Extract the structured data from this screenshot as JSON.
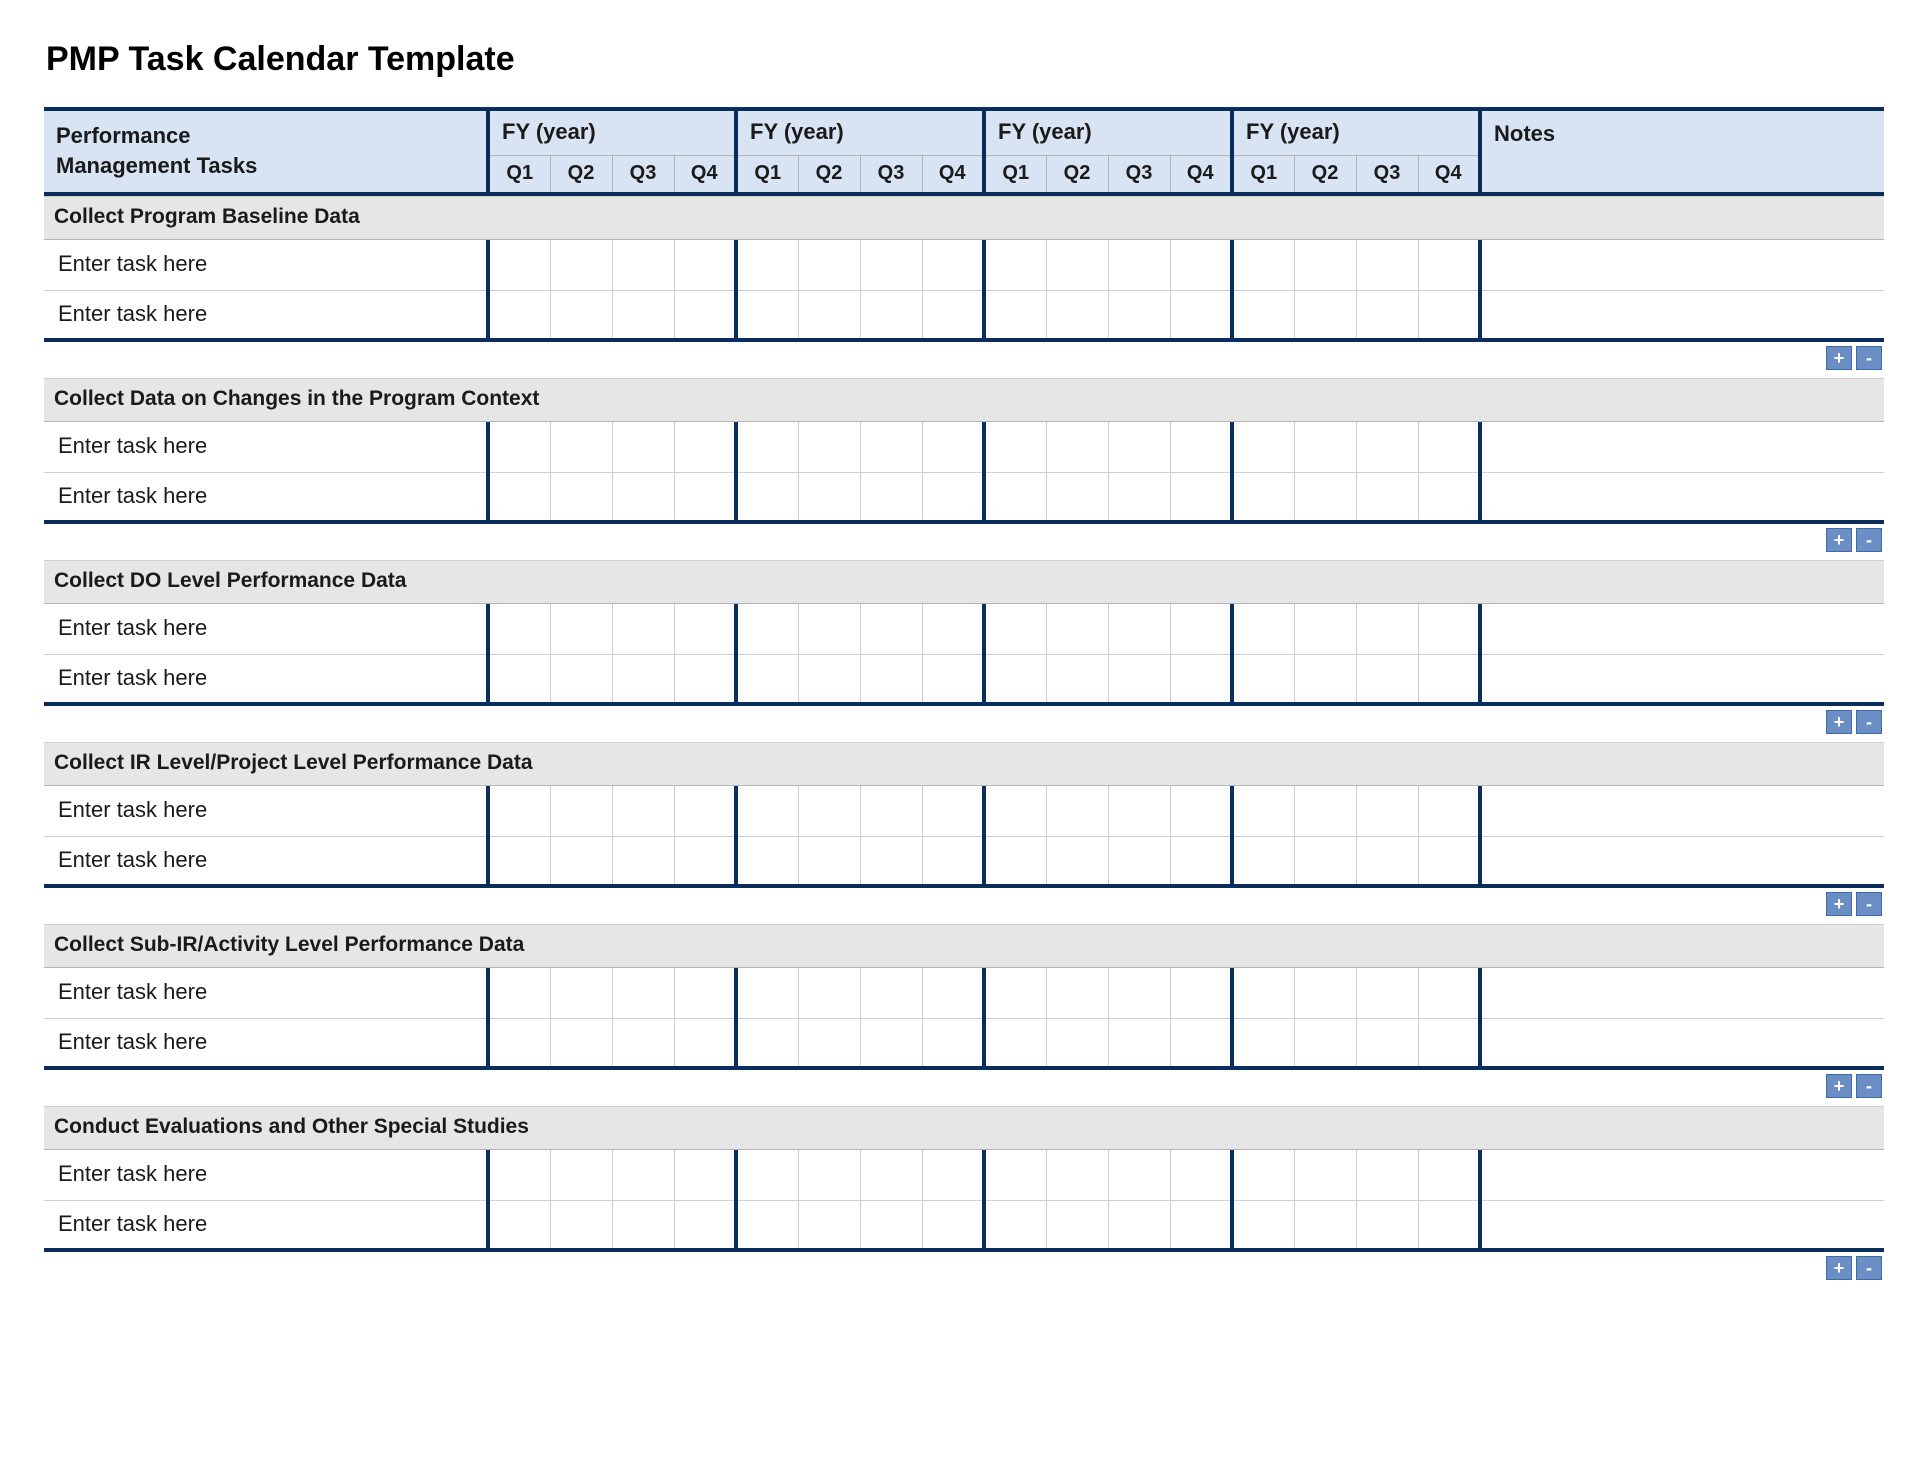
{
  "title": "PMP Task Calendar Template",
  "header": {
    "tasks_label_line1": "Performance",
    "tasks_label_line2": "Management Tasks",
    "fy_label": "FY  (year)",
    "quarters": [
      "Q1",
      "Q2",
      "Q3",
      "Q4"
    ],
    "notes_label": "Notes"
  },
  "task_placeholder": "Enter task here",
  "sections": [
    {
      "title": "Collect Program Baseline Data"
    },
    {
      "title": "Collect Data on Changes in the Program Context"
    },
    {
      "title": "Collect DO Level Performance Data"
    },
    {
      "title": "Collect IR Level/Project Level Performance Data"
    },
    {
      "title": "Collect Sub-IR/Activity Level Performance Data"
    },
    {
      "title": "Conduct Evaluations and Other Special Studies"
    }
  ],
  "buttons": {
    "add": "+",
    "remove": "-"
  }
}
